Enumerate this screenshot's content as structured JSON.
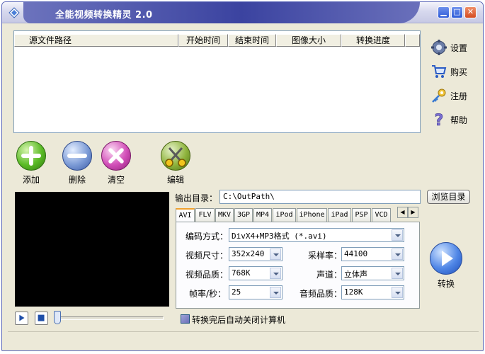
{
  "window": {
    "title": "全能视频转换精灵 2.0"
  },
  "file_list": {
    "columns": [
      "源文件路径",
      "开始时间",
      "结束时间",
      "图像大小",
      "转换进度"
    ],
    "rows": []
  },
  "sidebar": {
    "settings": "设置",
    "buy": "购买",
    "register": "注册",
    "help": "帮助"
  },
  "actions": {
    "add": "添加",
    "delete": "删除",
    "clear": "清空",
    "edit": "编辑"
  },
  "output": {
    "label": "输出目录：",
    "path": "C:\\OutPath\\",
    "browse": "浏览目录"
  },
  "format_tabs": [
    "AVI",
    "FLV",
    "MKV",
    "3GP",
    "MP4",
    "iPod",
    "iPhone",
    "iPad",
    "PSP",
    "VCD"
  ],
  "active_tab": "AVI",
  "settings_form": {
    "encoding_label": "编码方式：",
    "encoding_value": "DivX4+MP3格式 (*.avi)",
    "size_label": "视频尺寸：",
    "size_value": "352x240",
    "sample_rate_label": "采样率：",
    "sample_rate_value": "44100",
    "quality_label": "视频品质：",
    "quality_value": "768K",
    "channel_label": "声道：",
    "channel_value": "立体声",
    "fps_label": "帧率/秒：",
    "fps_value": "25",
    "audio_quality_label": "音频品质：",
    "audio_quality_value": "128K"
  },
  "convert": {
    "label": "转换"
  },
  "shutdown": {
    "label": "转换完后自动关闭计算机",
    "checked": false
  },
  "player": {
    "progress": 0
  }
}
